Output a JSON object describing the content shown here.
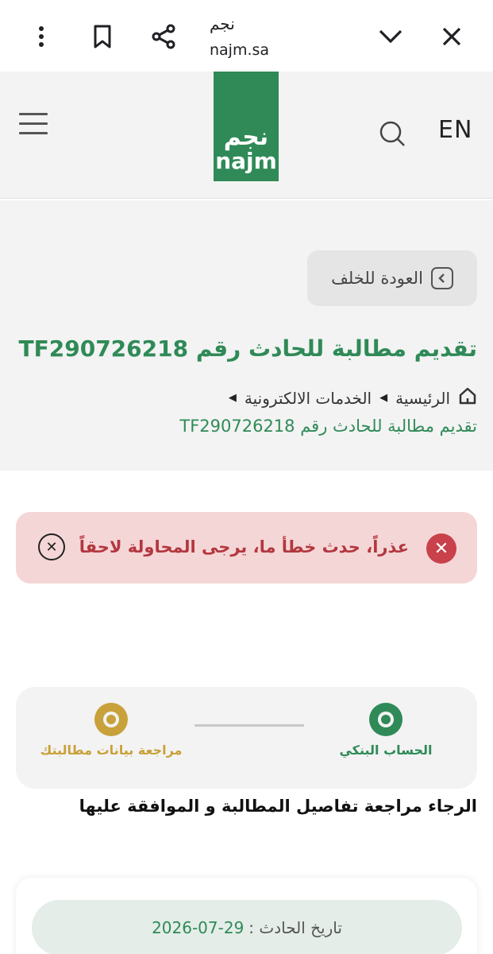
{
  "browser": {
    "title": "نجم",
    "url": "najm.sa",
    "icons": [
      "more-vert-icon",
      "bookmark-icon",
      "share-icon",
      "chevron-down-icon",
      "close-icon"
    ]
  },
  "header": {
    "logo_ar": "نجم",
    "logo_en": "najm",
    "lang": "EN",
    "brand_color": "#2f8a57"
  },
  "page": {
    "back_label": "العودة للخلف",
    "title": "تقديم مطالبة للحادث رقم TF290726218",
    "breadcrumb": {
      "home": "الرئيسية",
      "services": "الخدمات الالكترونية",
      "current": "تقديم مطالبة للحادث رقم TF290726218"
    }
  },
  "alert": {
    "message": "عذراً، حدث خطأ ما، يرجى المحاولة لاحقاً",
    "color": "#c8414b"
  },
  "stepper": {
    "steps": [
      {
        "label": "الحساب البنكي",
        "color": "#2f8a57"
      },
      {
        "label": "مراجعة بيانات مطالبتك",
        "color": "#c9a13a"
      }
    ]
  },
  "instructions": "الرجاء مراجعة تفاصيل المطالبة و الموافقة عليها",
  "details": {
    "date_label": "تاريخ الحادث :",
    "date_value": "2026-07-29"
  }
}
